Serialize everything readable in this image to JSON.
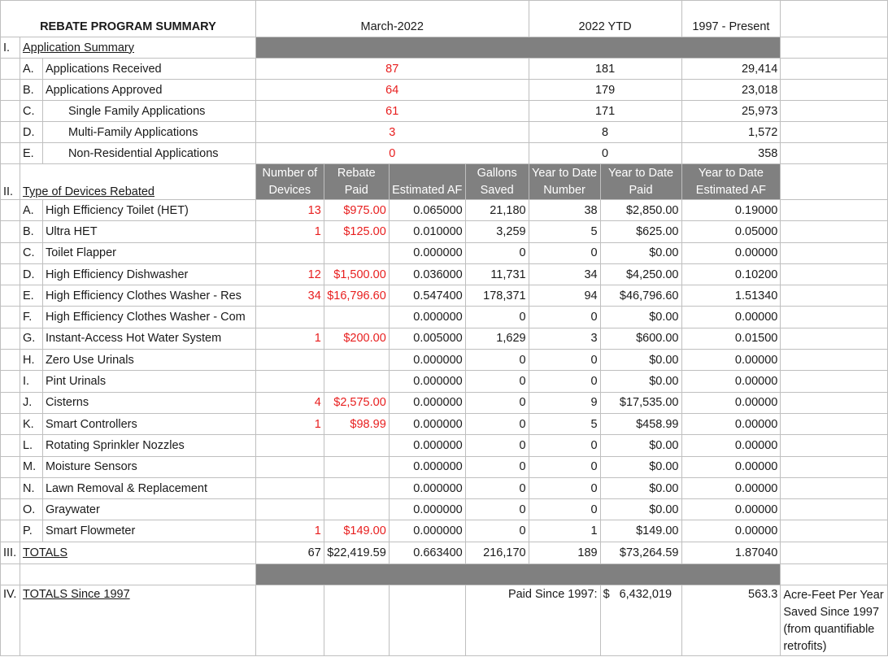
{
  "header": {
    "title": "REBATE PROGRAM SUMMARY",
    "period": "March-2022",
    "ytd": "2022  YTD",
    "since": "1997 - Present"
  },
  "application_summary": {
    "section": "I.",
    "label": "Application Summary",
    "rows": [
      {
        "letter": "A.",
        "label": "Applications Received",
        "month": "87",
        "ytd": "181",
        "total": "29,414"
      },
      {
        "letter": "B.",
        "label": "Applications Approved",
        "month": "64",
        "ytd": "179",
        "total": "23,018"
      },
      {
        "letter": "C.",
        "label": "Single Family Applications",
        "month": "61",
        "ytd": "171",
        "total": "25,973"
      },
      {
        "letter": "D.",
        "label": "Multi-Family Applications",
        "month": "3",
        "ytd": "8",
        "total": "1,572"
      },
      {
        "letter": "E.",
        "label": "Non-Residential Applications",
        "month": "0",
        "ytd": "0",
        "total": "358"
      }
    ]
  },
  "devices": {
    "section": "II.",
    "label": "Type of Devices Rebated",
    "columns": {
      "devices_1": "Number of",
      "devices_2": "Devices",
      "rebate_1": "Rebate",
      "rebate_2": "Paid",
      "af": "Estimated AF",
      "gallons_1": "Gallons",
      "gallons_2": "Saved",
      "ytdnum_1": "Year to Date",
      "ytdnum_2": "Number",
      "ytdpaid_1": "Year to Date",
      "ytdpaid_2": "Paid",
      "ytdaf_1": "Year to Date",
      "ytdaf_2": "Estimated AF"
    },
    "rows": [
      {
        "letter": "A.",
        "label": "High Efficiency Toilet (HET)",
        "count": "13",
        "paid": "$975.00",
        "af": "0.065000",
        "gallons": "21,180",
        "ytd_num": "38",
        "ytd_paid": "$2,850.00",
        "ytd_af": "0.19000"
      },
      {
        "letter": "B.",
        "label": "Ultra HET",
        "count": "1",
        "paid": "$125.00",
        "af": "0.010000",
        "gallons": "3,259",
        "ytd_num": "5",
        "ytd_paid": "$625.00",
        "ytd_af": "0.05000"
      },
      {
        "letter": "C.",
        "label": "Toilet Flapper",
        "count": "",
        "paid": "",
        "af": "0.000000",
        "gallons": "0",
        "ytd_num": "0",
        "ytd_paid": "$0.00",
        "ytd_af": "0.00000"
      },
      {
        "letter": "D.",
        "label": "High Efficiency Dishwasher",
        "count": "12",
        "paid": "$1,500.00",
        "af": "0.036000",
        "gallons": "11,731",
        "ytd_num": "34",
        "ytd_paid": "$4,250.00",
        "ytd_af": "0.10200"
      },
      {
        "letter": "E.",
        "label": "High Efficiency Clothes Washer - Res",
        "count": "34",
        "paid": "$16,796.60",
        "af": "0.547400",
        "gallons": "178,371",
        "ytd_num": "94",
        "ytd_paid": "$46,796.60",
        "ytd_af": "1.51340"
      },
      {
        "letter": "F.",
        "label": "High Efficiency Clothes Washer - Com",
        "count": "",
        "paid": "",
        "af": "0.000000",
        "gallons": "0",
        "ytd_num": "0",
        "ytd_paid": "$0.00",
        "ytd_af": "0.00000"
      },
      {
        "letter": "G.",
        "label": "Instant-Access Hot Water System",
        "count": "1",
        "paid": "$200.00",
        "af": "0.005000",
        "gallons": "1,629",
        "ytd_num": "3",
        "ytd_paid": "$600.00",
        "ytd_af": "0.01500"
      },
      {
        "letter": "H.",
        "label": "Zero Use Urinals",
        "count": "",
        "paid": "",
        "af": "0.000000",
        "gallons": "0",
        "ytd_num": "0",
        "ytd_paid": "$0.00",
        "ytd_af": "0.00000"
      },
      {
        "letter": "I.",
        "label": "Pint Urinals",
        "count": "",
        "paid": "",
        "af": "0.000000",
        "gallons": "0",
        "ytd_num": "0",
        "ytd_paid": "$0.00",
        "ytd_af": "0.00000"
      },
      {
        "letter": "J.",
        "label": "Cisterns",
        "count": "4",
        "paid": "$2,575.00",
        "af": "0.000000",
        "gallons": "0",
        "ytd_num": "9",
        "ytd_paid": "$17,535.00",
        "ytd_af": "0.00000"
      },
      {
        "letter": "K.",
        "label": "Smart Controllers",
        "count": "1",
        "paid": "$98.99",
        "af": "0.000000",
        "gallons": "0",
        "ytd_num": "5",
        "ytd_paid": "$458.99",
        "ytd_af": "0.00000"
      },
      {
        "letter": "L.",
        "label": "Rotating Sprinkler Nozzles",
        "count": "",
        "paid": "",
        "af": "0.000000",
        "gallons": "0",
        "ytd_num": "0",
        "ytd_paid": "$0.00",
        "ytd_af": "0.00000"
      },
      {
        "letter": "M.",
        "label": "Moisture Sensors",
        "count": "",
        "paid": "",
        "af": "0.000000",
        "gallons": "0",
        "ytd_num": "0",
        "ytd_paid": "$0.00",
        "ytd_af": "0.00000"
      },
      {
        "letter": "N.",
        "label": "Lawn Removal & Replacement",
        "count": "",
        "paid": "",
        "af": "0.000000",
        "gallons": "0",
        "ytd_num": "0",
        "ytd_paid": "$0.00",
        "ytd_af": "0.00000"
      },
      {
        "letter": "O.",
        "label": "Graywater",
        "count": "",
        "paid": "",
        "af": "0.000000",
        "gallons": "0",
        "ytd_num": "0",
        "ytd_paid": "$0.00",
        "ytd_af": "0.00000"
      },
      {
        "letter": "P.",
        "label": "Smart Flowmeter",
        "count": "1",
        "paid": "$149.00",
        "af": "0.000000",
        "gallons": "0",
        "ytd_num": "1",
        "ytd_paid": "$149.00",
        "ytd_af": "0.00000"
      }
    ]
  },
  "totals": {
    "section": "III.",
    "label": "TOTALS",
    "count": "67",
    "paid": "$22,419.59",
    "af": "0.663400",
    "gallons": "216,170",
    "ytd_num": "189",
    "ytd_paid": "$73,264.59",
    "ytd_af": "1.87040"
  },
  "since1997": {
    "section": "IV.",
    "label": "TOTALS Since 1997",
    "paid_label": "Paid Since 1997:",
    "currency": "$",
    "paid_value": "6,432,019",
    "af_value": "563.3",
    "af_note": "Acre-Feet Per Year Saved Since 1997 (from quantifiable retrofits)"
  },
  "colors": {
    "header_fill": "#808080",
    "highlight_text": "#e81e1e",
    "grid": "#bfbfbf"
  }
}
